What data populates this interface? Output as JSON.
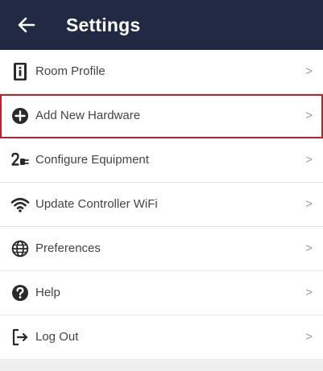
{
  "header": {
    "title": "Settings",
    "back_icon": "arrow-left-icon"
  },
  "menu": {
    "items": [
      {
        "id": "room-profile",
        "label": "Room Profile",
        "icon": "door-info-icon",
        "chevron": ">",
        "highlighted": false
      },
      {
        "id": "add-new-hardware",
        "label": "Add New Hardware",
        "icon": "plus-circle-icon",
        "chevron": ">",
        "highlighted": true
      },
      {
        "id": "configure-equipment",
        "label": "Configure Equipment",
        "icon": "plug-icon",
        "chevron": ">",
        "highlighted": false
      },
      {
        "id": "update-controller-wifi",
        "label": "Update Controller WiFi",
        "icon": "wifi-icon",
        "chevron": ">",
        "highlighted": false
      },
      {
        "id": "preferences",
        "label": "Preferences",
        "icon": "globe-icon",
        "chevron": ">",
        "highlighted": false
      },
      {
        "id": "help",
        "label": "Help",
        "icon": "help-circle-icon",
        "chevron": ">",
        "highlighted": false
      },
      {
        "id": "log-out",
        "label": "Log Out",
        "icon": "logout-icon",
        "chevron": ">",
        "highlighted": false
      }
    ]
  },
  "colors": {
    "header_bg": "#222942",
    "highlight_border": "#b3262e",
    "icon": "#2a2a2a",
    "text": "#444444"
  }
}
